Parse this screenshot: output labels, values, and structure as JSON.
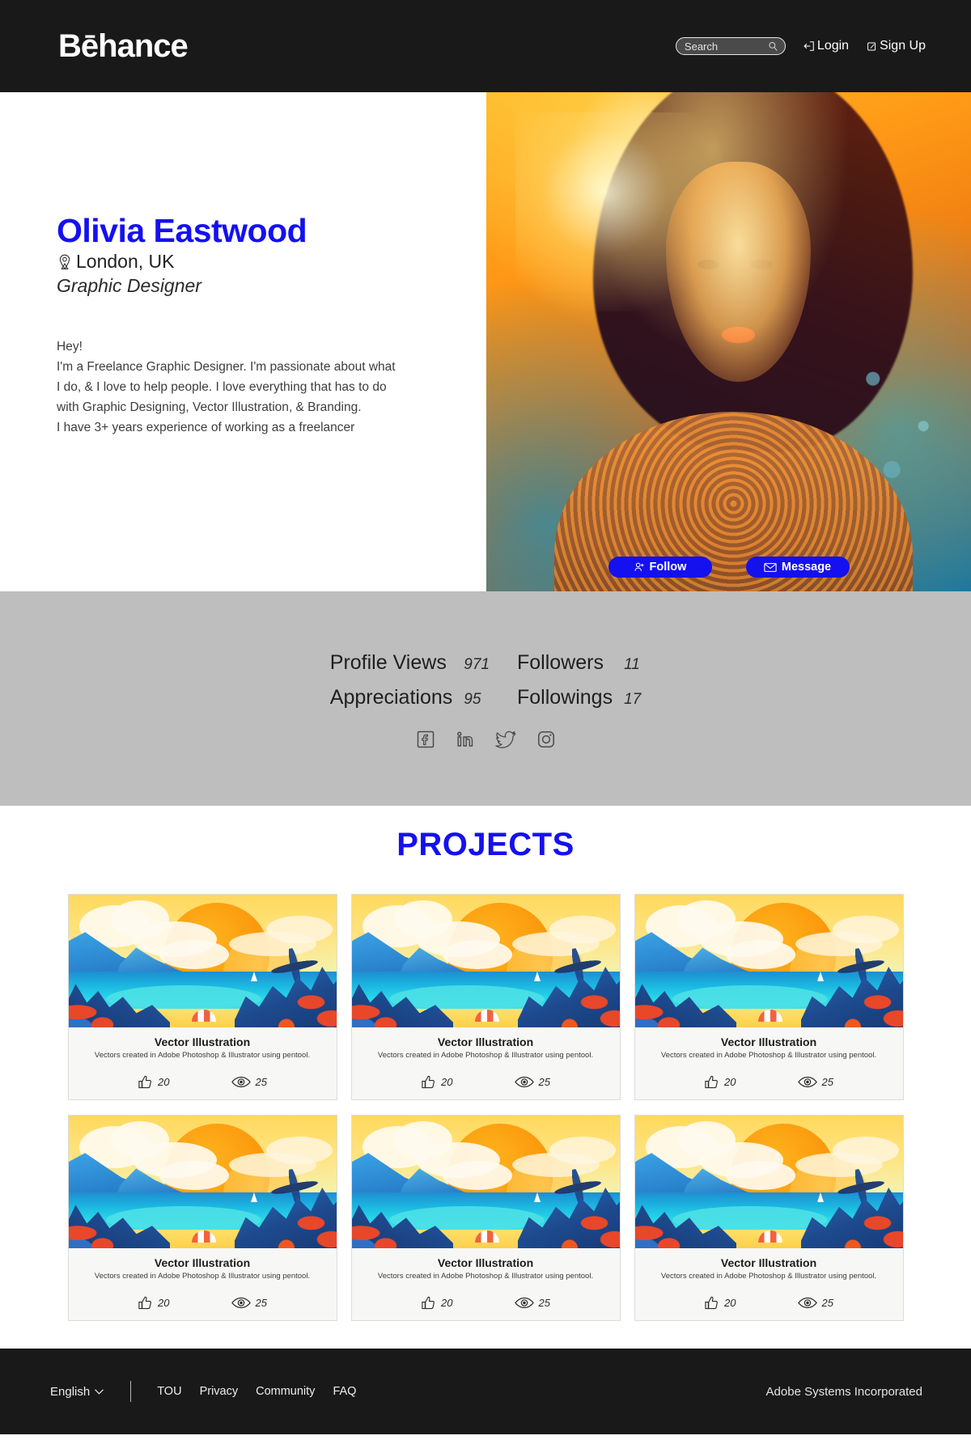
{
  "header": {
    "brand": "Bēhance",
    "search": {
      "placeholder": "Search",
      "value": "Search",
      "icon": "search-icon"
    },
    "login": {
      "label": "Login",
      "icon": "login-icon"
    },
    "signup": {
      "label": "Sign Up",
      "icon": "signup-icon"
    }
  },
  "profile": {
    "name": "Olivia Eastwood",
    "location": "London, UK",
    "location_icon": "map-pin-icon",
    "role": "Graphic Designer",
    "bio": "Hey!\nI'm a Freelance Graphic Designer. I'm passionate about what\nI do, & I love to help people. I love everything that has to do\nwith Graphic Designing, Vector Illustration, & Branding.\nI have 3+ years experience of working as a freelancer",
    "follow_button": {
      "label": "Follow",
      "icon": "user-add-icon"
    },
    "message_button": {
      "label": "Message",
      "icon": "envelope-icon"
    },
    "accent_color": "#1510f0"
  },
  "stats": {
    "items": [
      {
        "label": "Profile Views",
        "value": "971"
      },
      {
        "label": "Followers",
        "value": "11"
      },
      {
        "label": "Appreciations",
        "value": "95"
      },
      {
        "label": "Followings",
        "value": "17"
      }
    ],
    "socials": [
      {
        "name": "facebook-icon",
        "label": "Facebook"
      },
      {
        "name": "linkedin-icon",
        "label": "LinkedIn"
      },
      {
        "name": "twitter-icon",
        "label": "Twitter"
      },
      {
        "name": "instagram-icon",
        "label": "Instagram"
      }
    ],
    "background_color": "#bebebe"
  },
  "projects": {
    "title": "PROJECTS",
    "cards": [
      {
        "title": "Vector Illustration",
        "desc": "Vectors created in Adobe Photoshop & Illustrator using pentool.",
        "likes": "20",
        "views": "25"
      },
      {
        "title": "Vector Illustration",
        "desc": "Vectors created in Adobe Photoshop & Illustrator using pentool.",
        "likes": "20",
        "views": "25"
      },
      {
        "title": "Vector Illustration",
        "desc": "Vectors created in Adobe Photoshop & Illustrator using pentool.",
        "likes": "20",
        "views": "25"
      },
      {
        "title": "Vector Illustration",
        "desc": "Vectors created in Adobe Photoshop & Illustrator using pentool.",
        "likes": "20",
        "views": "25"
      },
      {
        "title": "Vector Illustration",
        "desc": "Vectors created in Adobe Photoshop & Illustrator using pentool.",
        "likes": "20",
        "views": "25"
      },
      {
        "title": "Vector Illustration",
        "desc": "Vectors created in Adobe Photoshop & Illustrator using pentool.",
        "likes": "20",
        "views": "25"
      }
    ],
    "like_icon": "thumbs-up-icon",
    "view_icon": "eye-icon"
  },
  "footer": {
    "language": "English",
    "language_icon": "chevron-down-icon",
    "links": [
      "TOU",
      "Privacy",
      "Community",
      "FAQ"
    ],
    "copyright": "Adobe Systems Incorporated"
  }
}
